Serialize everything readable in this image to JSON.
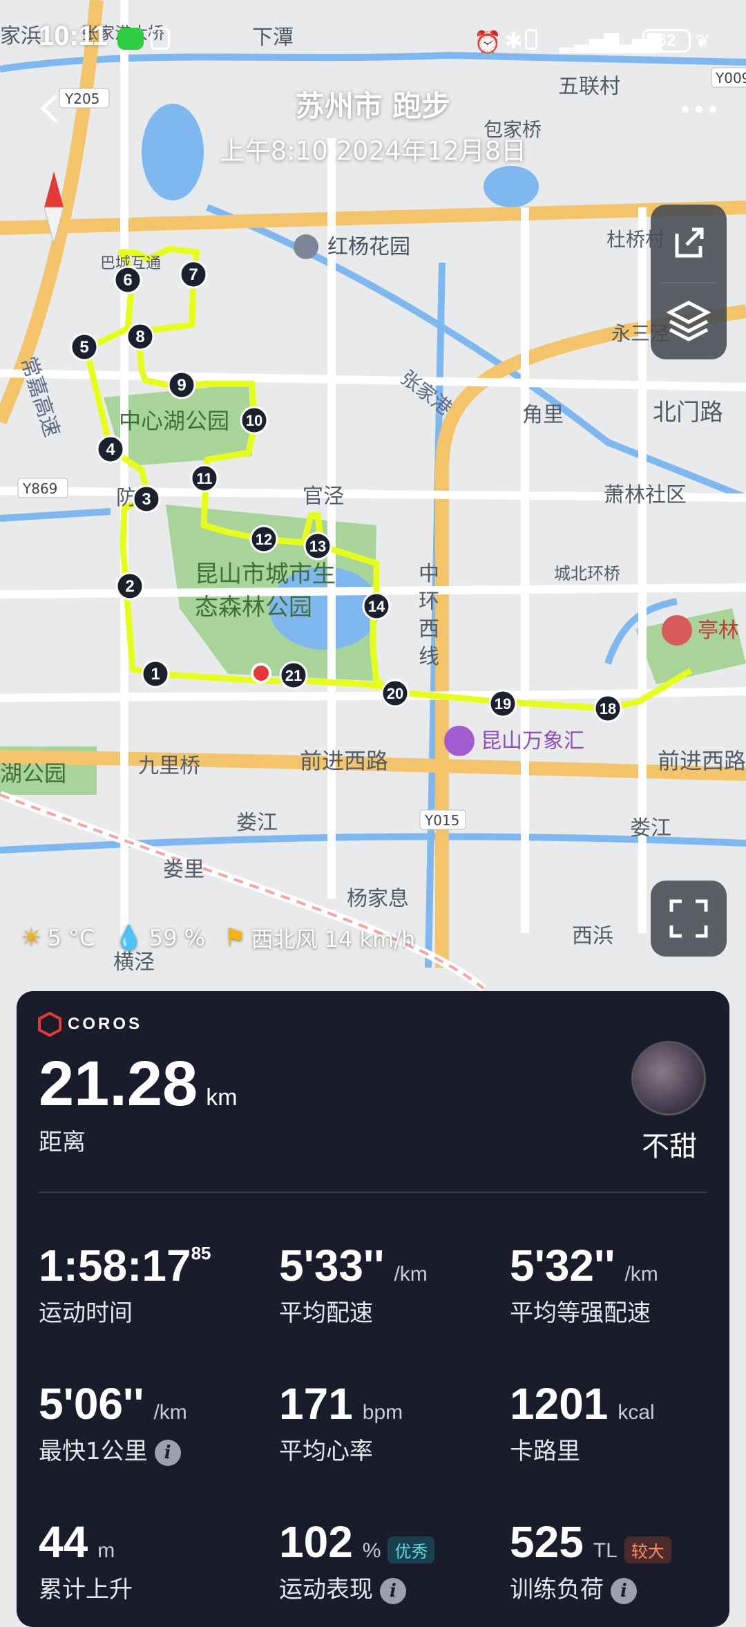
{
  "status_bar": {
    "time": "10:11",
    "battery": "62"
  },
  "header": {
    "title": "苏州市 跑步",
    "subtitle": "上午8:10 2024年12月8日"
  },
  "map": {
    "labels": {
      "jiajia": "家浜",
      "zhangjiagang_bridge": "张家港大桥",
      "xiatan": "下潭",
      "wulian": "五联村",
      "y205": "Y205",
      "y009": "Y009",
      "baojiaqiao": "包家桥",
      "dutiqiao": "杜桥村",
      "hongyang": "红杨花园",
      "bacheng": "巴城互通",
      "changjia": "常嘉高速",
      "yongsan": "永三泾",
      "zhangjiagang_river": "张家港",
      "jiaoli": "角里",
      "beimen": "北门路",
      "zhongxinhu": "中心湖公园",
      "y869": "Y869",
      "gangang": "防港",
      "guanjing": "官泾",
      "xiaolin": "萧林社区",
      "forest_park": "昆山市城市生态森林公园",
      "zhonghuan": "中环西线",
      "chengbei": "城北环桥",
      "tinglin": "亭林",
      "wanxiang": "昆山万象汇",
      "huhu": "湖公园",
      "jiuliqiao": "九里桥",
      "qianjin_w": "前进西路",
      "qianjin_e": "前进西路",
      "y015": "Y015",
      "loujiang_w": "娄江",
      "loujiang_e": "娄江",
      "louli": "娄里",
      "yangjiaxi": "杨家息",
      "xibang": "西浜",
      "hengjing": "横泾"
    },
    "markers": [
      "1",
      "2",
      "3",
      "4",
      "5",
      "6",
      "7",
      "8",
      "9",
      "10",
      "11",
      "12",
      "13",
      "14",
      "18",
      "19",
      "20",
      "21"
    ],
    "route_color": "#e5ff1a"
  },
  "weather": {
    "temp": "5 °C",
    "humidity": "59 %",
    "wind": "西北风 14 km/h"
  },
  "card": {
    "brand": "COROS",
    "distance": {
      "value": "21.28",
      "unit": "km",
      "label": "距离"
    },
    "user": {
      "name": "不甜"
    },
    "stats": [
      {
        "value": "1:58:17",
        "sup": "85",
        "unit": "",
        "label": "运动时间"
      },
      {
        "value": "5'33''",
        "unit": "/km",
        "label": "平均配速"
      },
      {
        "value": "5'32''",
        "unit": "/km",
        "label": "平均等强配速"
      },
      {
        "value": "5'06''",
        "unit": "/km",
        "label": "最快1公里"
      },
      {
        "value": "171",
        "unit": "bpm",
        "label": "平均心率"
      },
      {
        "value": "1201",
        "unit": "kcal",
        "label": "卡路里"
      },
      {
        "value": "44",
        "unit": "m",
        "label": "累计上升"
      },
      {
        "value": "102",
        "unit": "%",
        "label": "运动表现",
        "tag": "优秀"
      },
      {
        "value": "525",
        "unit": "TL",
        "label": "训练负荷",
        "tag": "较大"
      }
    ]
  }
}
